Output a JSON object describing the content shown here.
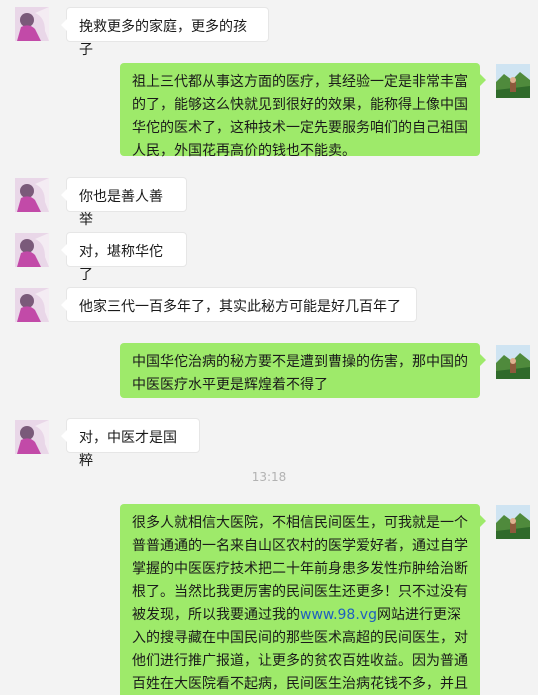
{
  "colors": {
    "background": "#f3f3f3",
    "bubble_self": "#9eea6a",
    "bubble_other": "#ffffff",
    "link": "#1f5fbf",
    "timestamp": "#b2b2b2"
  },
  "messages": [
    {
      "sender": "other",
      "avatar": "contact-avatar",
      "text": "挽救更多的家庭，更多的孩子"
    },
    {
      "sender": "self",
      "avatar": "user-avatar",
      "text": "祖上三代都从事这方面的医疗，其经验一定是非常丰富的了，能够这么快就见到很好的效果，能称得上像中国华佗的医术了，这种技术一定先要服务咱们的自己祖国人民，外国花再高价的钱也不能卖。"
    },
    {
      "sender": "other",
      "avatar": "contact-avatar",
      "text": "你也是善人善举"
    },
    {
      "sender": "other",
      "avatar": "contact-avatar",
      "text": "对，堪称华佗了"
    },
    {
      "sender": "other",
      "avatar": "contact-avatar",
      "text": "他家三代一百多年了，其实此秘方可能是好几百年了"
    },
    {
      "sender": "self",
      "avatar": "user-avatar",
      "text": "中国华佗治病的秘方要不是遭到曹操的伤害，那中国的中医医疗水平更是辉煌着不得了"
    },
    {
      "sender": "other",
      "avatar": "contact-avatar",
      "text": "对，中医才是国粹"
    }
  ],
  "timestamp": "13:18",
  "last_message": {
    "sender": "self",
    "avatar": "user-avatar",
    "text_before": "很多人就相信大医院，不相信民间医生，可我就是一个普普通通的一名来自山区农村的医学爱好者，通过自学掌握的中医医疗技术把二十年前身患多发性疖肿给治断根了。当然比我更厉害的民间医生还更多！只不过没有被发现，所以我要通过我的",
    "link": "www.98.vg",
    "text_after": "网站进行更深入的搜寻藏在中国民间的那些医术高超的民间医生，对他们进行推广报道，让更多的贫农百姓收益。因为普通百姓在大医院看不起病，民间医生治病花钱不多，并且还出奇的好！"
  }
}
